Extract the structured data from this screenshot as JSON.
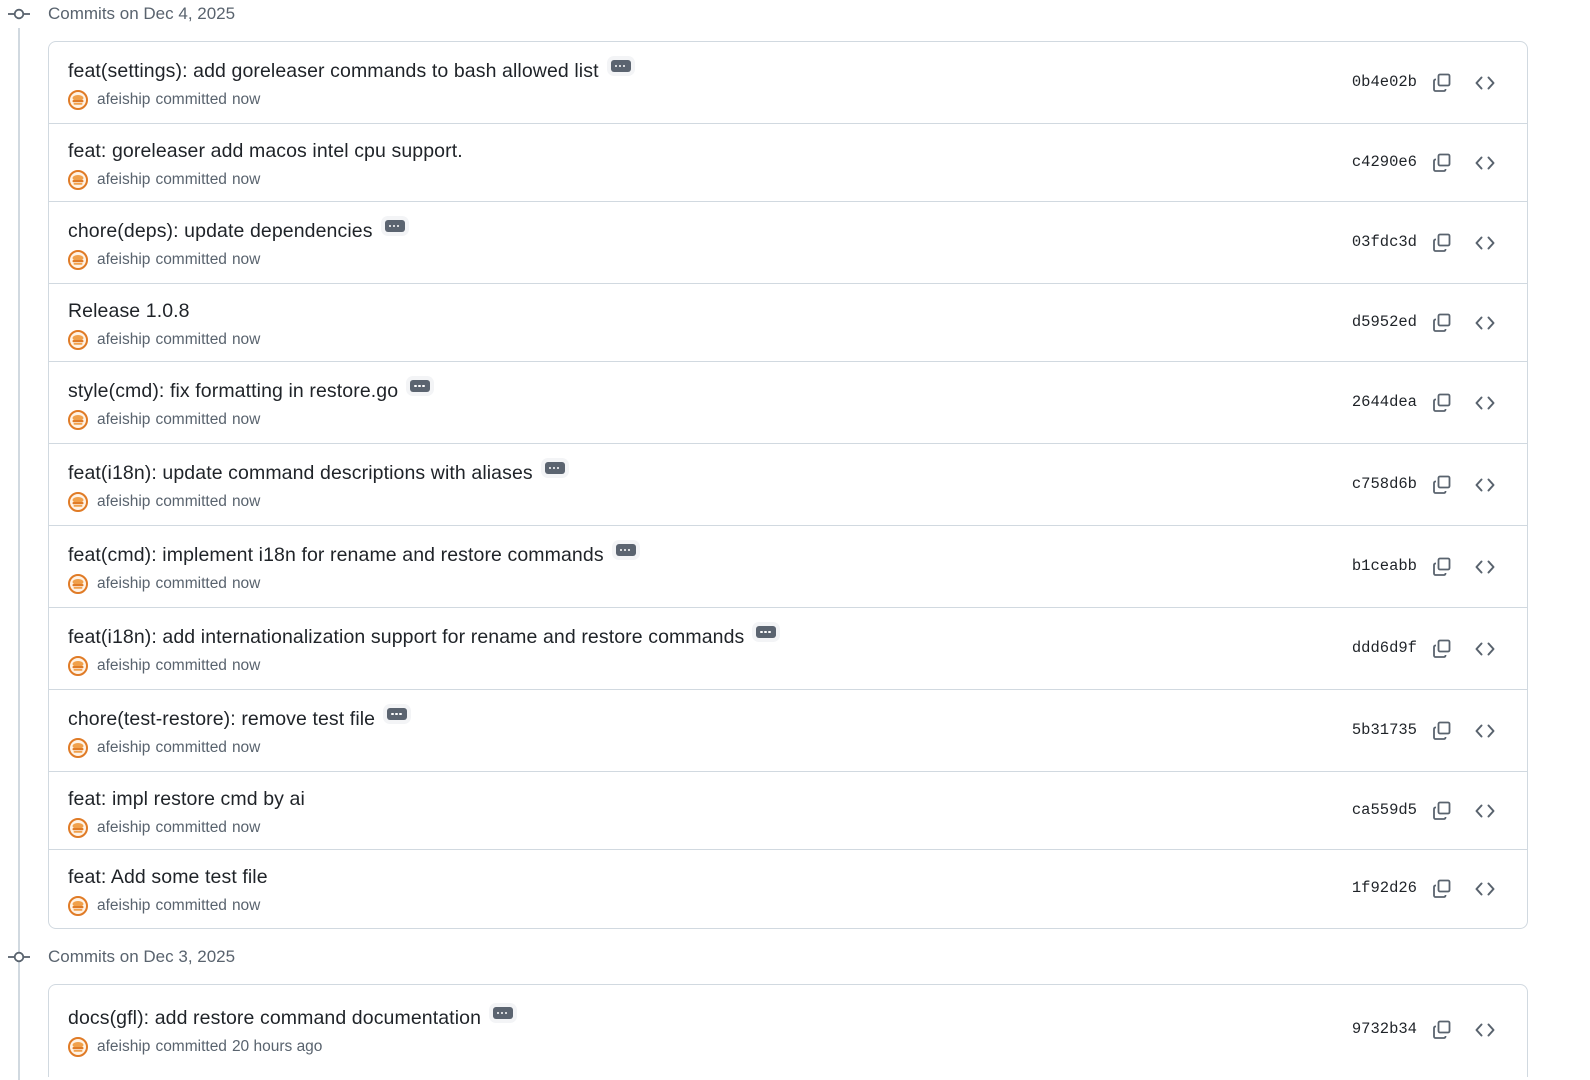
{
  "groups": [
    {
      "title": "Commits on Dec 4, 2025",
      "commits": [
        {
          "message": "feat(settings): add goreleaser commands to bash allowed list",
          "has_more": true,
          "author": "afeiship",
          "action": "committed",
          "time": "now",
          "sha": "0b4e02b"
        },
        {
          "message": "feat: goreleaser add macos intel cpu support.",
          "has_more": false,
          "author": "afeiship",
          "action": "committed",
          "time": "now",
          "sha": "c4290e6"
        },
        {
          "message": "chore(deps): update dependencies",
          "has_more": true,
          "author": "afeiship",
          "action": "committed",
          "time": "now",
          "sha": "03fdc3d"
        },
        {
          "message": "Release 1.0.8",
          "has_more": false,
          "author": "afeiship",
          "action": "committed",
          "time": "now",
          "sha": "d5952ed"
        },
        {
          "message": "style(cmd): fix formatting in restore.go",
          "has_more": true,
          "author": "afeiship",
          "action": "committed",
          "time": "now",
          "sha": "2644dea"
        },
        {
          "message": "feat(i18n): update command descriptions with aliases",
          "has_more": true,
          "author": "afeiship",
          "action": "committed",
          "time": "now",
          "sha": "c758d6b"
        },
        {
          "message": "feat(cmd): implement i18n for rename and restore commands",
          "has_more": true,
          "author": "afeiship",
          "action": "committed",
          "time": "now",
          "sha": "b1ceabb"
        },
        {
          "message": "feat(i18n): add internationalization support for rename and restore commands",
          "has_more": true,
          "author": "afeiship",
          "action": "committed",
          "time": "now",
          "sha": "ddd6d9f"
        },
        {
          "message": "chore(test-restore): remove test file",
          "has_more": true,
          "author": "afeiship",
          "action": "committed",
          "time": "now",
          "sha": "5b31735"
        },
        {
          "message": "feat: impl restore cmd by ai",
          "has_more": false,
          "author": "afeiship",
          "action": "committed",
          "time": "now",
          "sha": "ca559d5"
        },
        {
          "message": "feat: Add some test file",
          "has_more": false,
          "author": "afeiship",
          "action": "committed",
          "time": "now",
          "sha": "1f92d26"
        }
      ]
    },
    {
      "title": "Commits on Dec 3, 2025",
      "commits": [
        {
          "message": "docs(gfl): add restore command documentation",
          "has_more": true,
          "author": "afeiship",
          "action": "committed",
          "time": "20 hours ago",
          "sha": "9732b34"
        }
      ]
    }
  ],
  "icons": {
    "commit_node": "git-commit-icon",
    "avatar": "user-avatar-icon",
    "more": "kebab-horizontal-icon",
    "copy": "copy-icon",
    "browse": "code-icon"
  },
  "colors": {
    "border": "#d1d9e0",
    "muted_text": "#59636e",
    "main_text": "#1f2328",
    "ellipsis_bg": "#5b6470",
    "avatar_orange": "#e07b26"
  }
}
